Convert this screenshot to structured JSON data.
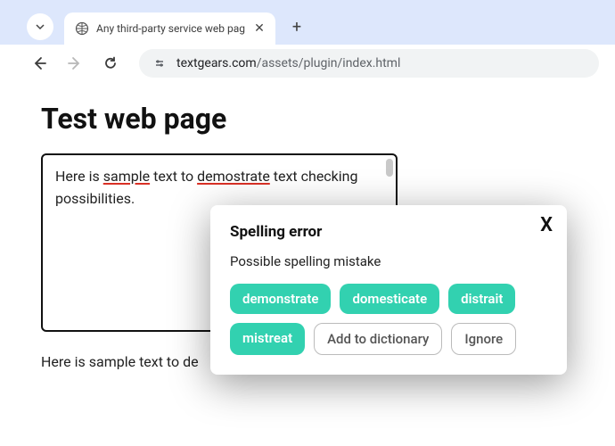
{
  "browser": {
    "tab_title": "Any third-party service web pag",
    "url_domain": "textgears.com",
    "url_path": "/assets/plugin/index.html"
  },
  "page": {
    "heading": "Test web page",
    "editor_text_parts": {
      "p1": "Here is ",
      "err1": "sample",
      "p2": " text to ",
      "err2": "demostrate",
      "p3": " text checking possibilities."
    },
    "below_text": "Here is sample text to de"
  },
  "popup": {
    "title": "Spelling error",
    "description": "Possible spelling mistake",
    "suggestions": [
      "demonstrate",
      "domesticate",
      "distrait",
      "mistreat"
    ],
    "add_to_dictionary": "Add to dictionary",
    "ignore": "Ignore",
    "close": "X"
  }
}
